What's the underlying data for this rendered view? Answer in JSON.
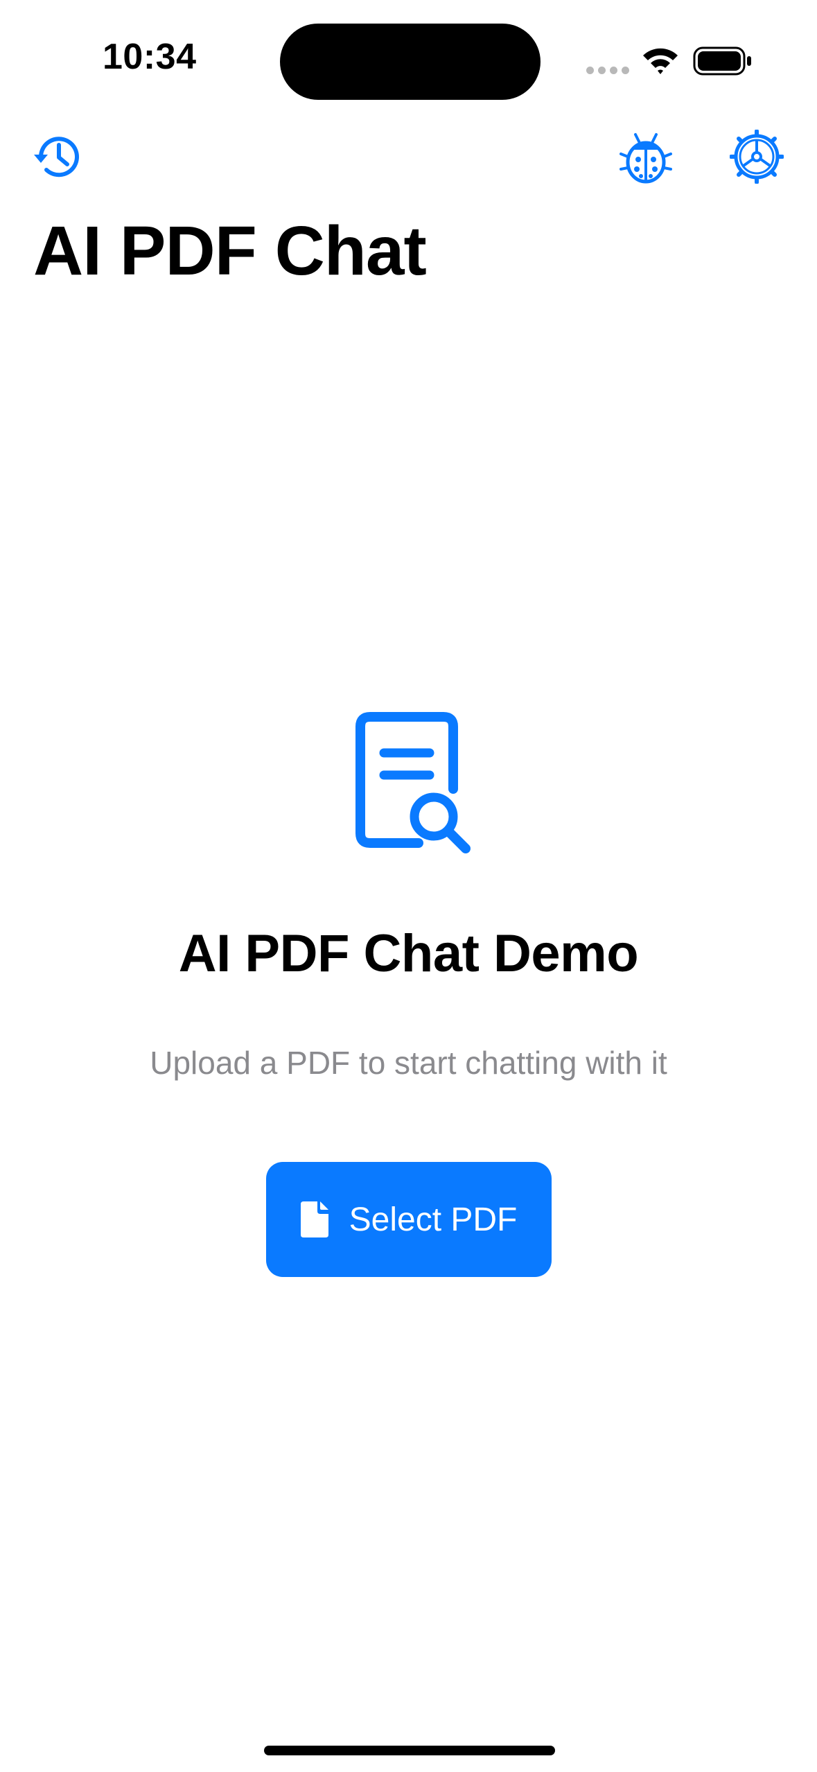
{
  "status_bar": {
    "time": "10:34"
  },
  "nav": {
    "left_icon": "history-icon",
    "right_icons": [
      "ladybug-icon",
      "gear-icon"
    ]
  },
  "header": {
    "title": "AI PDF Chat"
  },
  "empty_state": {
    "icon": "document-search-icon",
    "title": "AI PDF Chat Demo",
    "subtitle": "Upload a PDF to start chatting with it",
    "button_label": "Select PDF",
    "button_icon": "document-icon"
  },
  "colors": {
    "accent": "#0a7aff",
    "secondary_text": "#8a8a8e"
  }
}
